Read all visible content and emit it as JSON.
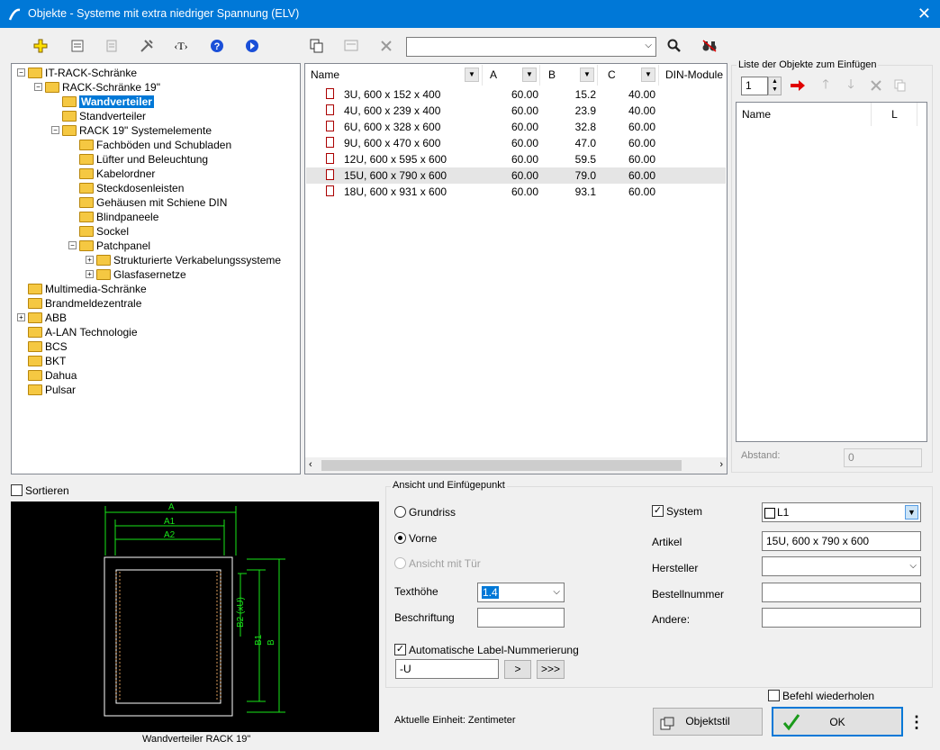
{
  "window": {
    "title": "Objekte - Systeme mit extra niedriger Spannung (ELV)",
    "close_glyph": "✕"
  },
  "toolbar": {
    "search_value": "",
    "icons": [
      "add-icon",
      "properties-icon",
      "list-icon",
      "tools-icon",
      "text-icon",
      "help-icon",
      "play-icon",
      "copy-icon",
      "filter-icon",
      "delete-icon",
      "search-icon",
      "binoculars-icon"
    ]
  },
  "tree": [
    {
      "label": "IT-RACK-Schränke",
      "level": 0,
      "pm": "−"
    },
    {
      "label": "RACK-Schränke 19\"",
      "level": 1,
      "pm": "−"
    },
    {
      "label": "Wandverteiler",
      "level": 2,
      "pm": "",
      "selected": true
    },
    {
      "label": "Standverteiler",
      "level": 2,
      "pm": ""
    },
    {
      "label": "RACK 19\" Systemelemente",
      "level": 2,
      "pm": "−"
    },
    {
      "label": "Fachböden und Schubladen",
      "level": 3,
      "pm": ""
    },
    {
      "label": "Lüfter und Beleuchtung",
      "level": 3,
      "pm": ""
    },
    {
      "label": "Kabelordner",
      "level": 3,
      "pm": ""
    },
    {
      "label": "Steckdosenleisten",
      "level": 3,
      "pm": ""
    },
    {
      "label": "Gehäusen mit Schiene DIN",
      "level": 3,
      "pm": ""
    },
    {
      "label": "Blindpaneele",
      "level": 3,
      "pm": ""
    },
    {
      "label": "Sockel",
      "level": 3,
      "pm": ""
    },
    {
      "label": "Patchpanel",
      "level": 3,
      "pm": "−"
    },
    {
      "label": "Strukturierte Verkabelungssysteme",
      "level": 4,
      "pm": "+"
    },
    {
      "label": "Glasfasernetze",
      "level": 4,
      "pm": "+"
    },
    {
      "label": "Multimedia-Schränke",
      "level": 0,
      "pm": ""
    },
    {
      "label": "Brandmeldezentrale",
      "level": 0,
      "pm": ""
    },
    {
      "label": "ABB",
      "level": 0,
      "pm": "+"
    },
    {
      "label": "A-LAN Technologie",
      "level": 0,
      "pm": ""
    },
    {
      "label": "BCS",
      "level": 0,
      "pm": ""
    },
    {
      "label": "BKT",
      "level": 0,
      "pm": ""
    },
    {
      "label": "Dahua",
      "level": 0,
      "pm": ""
    },
    {
      "label": "Pulsar",
      "level": 0,
      "pm": ""
    }
  ],
  "list": {
    "headers": [
      "Name",
      "A",
      "B",
      "C",
      "DIN-Module"
    ],
    "rows": [
      [
        "3U, 600 x 152 x 400",
        "60.00",
        "15.2",
        "40.00"
      ],
      [
        "4U, 600 x 239 x 400",
        "60.00",
        "23.9",
        "40.00"
      ],
      [
        "6U, 600 x 328 x 600",
        "60.00",
        "32.8",
        "60.00"
      ],
      [
        "9U, 600 x 470 x 600",
        "60.00",
        "47.0",
        "60.00"
      ],
      [
        "12U, 600 x 595 x 600",
        "60.00",
        "59.5",
        "60.00"
      ],
      [
        "15U, 600 x 790 x 600",
        "60.00",
        "79.0",
        "60.00"
      ],
      [
        "18U, 600 x 931 x 600",
        "60.00",
        "93.1",
        "60.00"
      ]
    ],
    "highlighted_row": 5
  },
  "insert_list": {
    "title": "Liste der Objekte zum Einfügen",
    "count": "1",
    "col_name": "Name",
    "col_l": "L",
    "spacing_label": "Abstand:",
    "spacing_value": "0"
  },
  "sort_label": "Sortieren",
  "preview": {
    "caption": "Wandverteiler RACK 19\"",
    "dims": [
      "A",
      "A1",
      "A2",
      "B",
      "B1",
      "B2 (xU)"
    ]
  },
  "view": {
    "group_title": "Ansicht und Einfügepunkt",
    "radio_grundriss": "Grundriss",
    "radio_vorne": "Vorne",
    "radio_tuer": "Ansicht mit Tür",
    "texthoehe_label": "Texthöhe",
    "texthoehe_value": "1.4",
    "beschriftung_label": "Beschriftung",
    "beschriftung_value": "",
    "auto_label": "Automatische Label-Nummerierung",
    "auto_value": "-U",
    "btn_next": ">",
    "btn_all": ">>>"
  },
  "right": {
    "system_label": "System",
    "system_value": "L1",
    "artikel_label": "Artikel",
    "artikel_value": "15U, 600 x 790 x 600",
    "hersteller_label": "Hersteller",
    "hersteller_value": "",
    "bestell_label": "Bestellnummer",
    "bestell_value": "",
    "andere_label": "Andere:",
    "andere_value": ""
  },
  "footer": {
    "unit": "Aktuelle Einheit: Zentimeter",
    "repeat": "Befehl wiederholen",
    "objektstil": "Objektstil",
    "ok": "OK",
    "more": "⋮"
  }
}
